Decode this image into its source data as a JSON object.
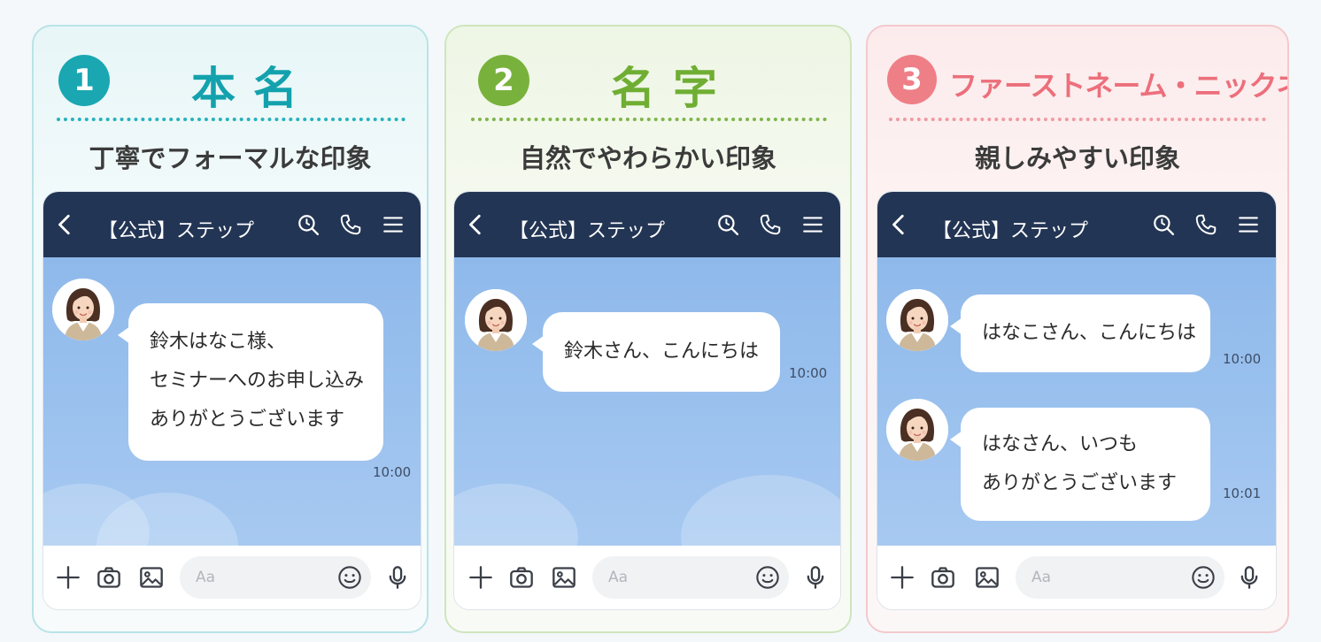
{
  "panels": [
    {
      "number": "1",
      "title": "本名",
      "subtitle": "丁寧でフォーマルな印象",
      "chat_title": "【公式】ステップ",
      "messages": [
        {
          "lines": [
            "鈴木はなこ様、",
            "セミナーへのお申し込み",
            "ありがとうございます"
          ],
          "time": "10:00"
        }
      ],
      "input_placeholder": "Aa"
    },
    {
      "number": "2",
      "title": "名字",
      "subtitle": "自然でやわらかい印象",
      "chat_title": "【公式】ステップ",
      "messages": [
        {
          "lines": [
            "鈴木さん、こんにちは"
          ],
          "time": "10:00"
        }
      ],
      "input_placeholder": "Aa"
    },
    {
      "number": "3",
      "title": "ファーストネーム・ニックネーム",
      "subtitle": "親しみやすい印象",
      "chat_title": "【公式】ステップ",
      "messages": [
        {
          "lines": [
            "はなこさん、こんにちは"
          ],
          "time": "10:00"
        },
        {
          "lines": [
            "はなさん、いつも",
            "ありがとうございます"
          ],
          "time": "10:01"
        }
      ],
      "input_placeholder": "Aa"
    }
  ],
  "colors": {
    "panel1_accent": "#13a2ad",
    "panel2_accent": "#6fae33",
    "panel3_accent": "#ec6f7b",
    "header_bar": "#233554",
    "chat_background": "#9ac1ee"
  },
  "icons": [
    "back-chevron-icon",
    "search-icon",
    "phone-icon",
    "menu-icon",
    "plus-icon",
    "camera-icon",
    "image-icon",
    "emoji-icon",
    "microphone-icon"
  ]
}
